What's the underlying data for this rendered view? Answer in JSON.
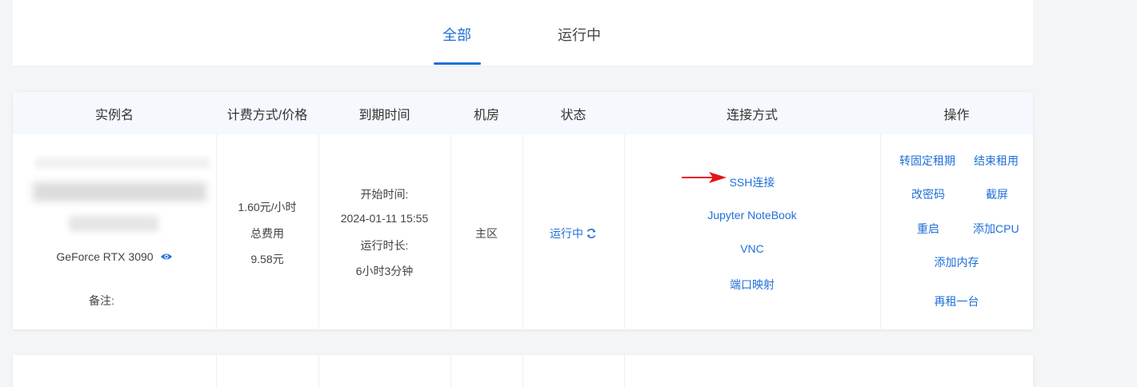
{
  "tabs": [
    {
      "label": "全部",
      "active": true
    },
    {
      "label": "运行中",
      "active": false
    }
  ],
  "table": {
    "headers": [
      "实例名",
      "计费方式/价格",
      "到期时间",
      "机房",
      "状态",
      "连接方式",
      "操作"
    ]
  },
  "instance": {
    "gpu": "GeForce RTX 3090",
    "remark_label": "备注:",
    "price": "1.60元/小时",
    "total_label": "总费用",
    "total_value": "9.58元",
    "start_label": "开始时间:",
    "start_time": "2024-01-11 15:55",
    "runtime_label": "运行时长:",
    "runtime": "6小时3分钟",
    "region": "主区",
    "status": "运行中",
    "connections": [
      "SSH连接",
      "Jupyter NoteBook",
      "VNC",
      "端口映射"
    ],
    "actions": {
      "to_fixed": "转固定租期",
      "end_rent": "结束租用",
      "change_password": "改密码",
      "screenshot": "截屏",
      "restart": "重启",
      "add_cpu": "添加CPU",
      "add_memory": "添加内存",
      "rent_again": "再租一台"
    }
  },
  "colors": {
    "accent": "#1f6fd8",
    "annotation_arrow": "#e3141b"
  },
  "icons": {
    "view": "eye-icon",
    "status": "refresh-icon",
    "annotation": "arrow-icon"
  }
}
